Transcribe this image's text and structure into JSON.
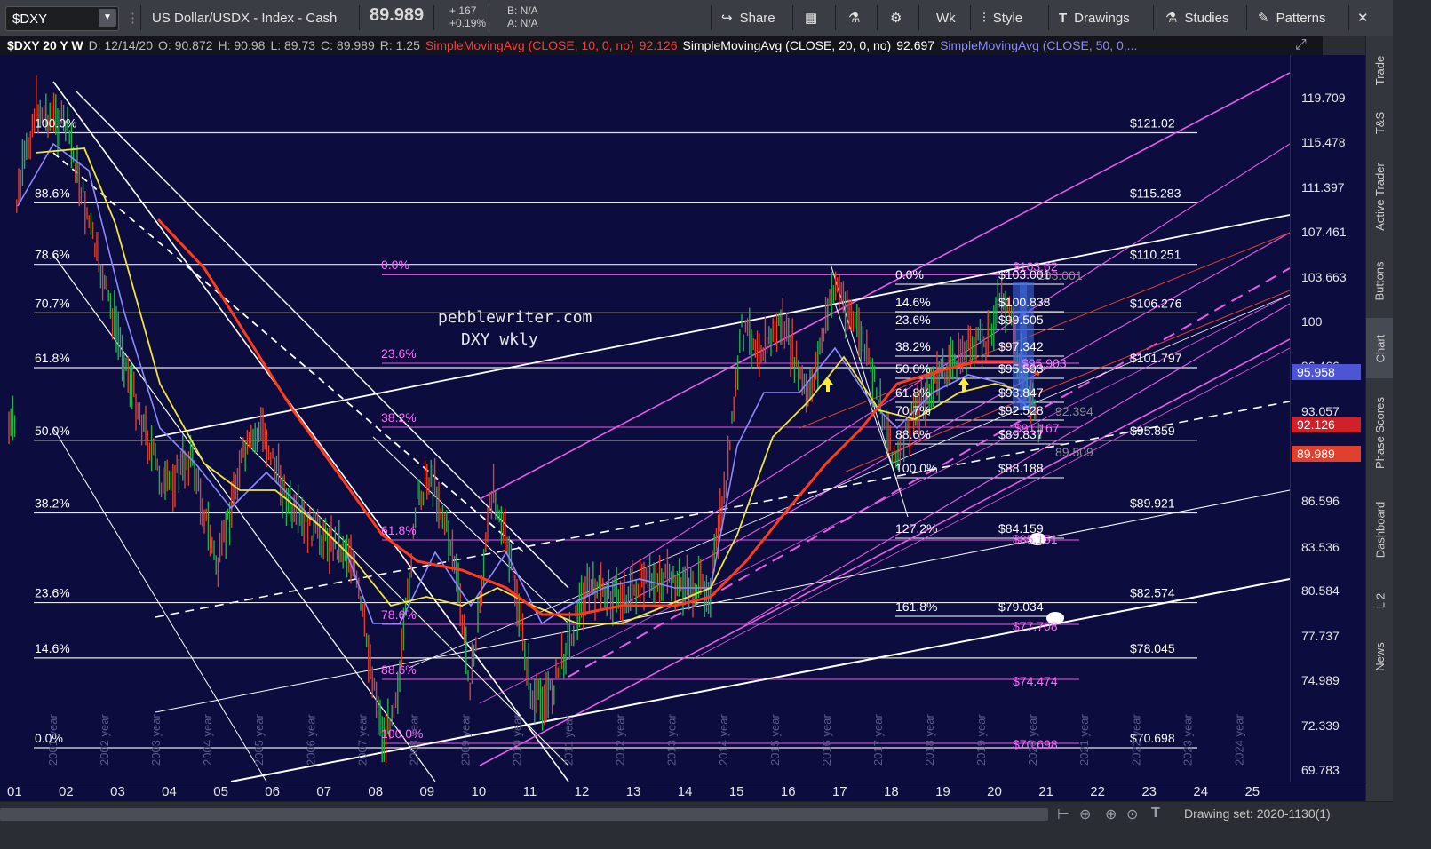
{
  "toolbar": {
    "symbol": "$DXY",
    "description": "US Dollar/USDX - Index - Cash",
    "last_price": "89.989",
    "change": "+.167",
    "change_pct": "+0.19%",
    "bid": "B: N/A",
    "ask": "A: N/A",
    "share": "Share",
    "period": "Wk",
    "style": "Style",
    "drawings": "Drawings",
    "studies": "Studies",
    "patterns": "Patterns"
  },
  "info_bar": {
    "symbol_tf": "$DXY 20 Y W",
    "date": "D: 12/14/20",
    "open": "O: 90.872",
    "high": "H: 90.98",
    "low": "L: 89.73",
    "close": "C: 89.989",
    "range": "R: 1.25",
    "sma10": "SimpleMovingAvg (CLOSE, 10, 0, no)",
    "sma10_val": "92.126",
    "sma20": "SimpleMovingAvg (CLOSE, 20, 0, no)",
    "sma20_val": "92.697",
    "sma50": "SimpleMovingAvg (CLOSE, 50, 0,..."
  },
  "watermark": {
    "line1": "pebblewriter.com",
    "line2": "DXY wkly"
  },
  "y_axis": {
    "labels": [
      "119.709",
      "115.478",
      "111.397",
      "107.461",
      "103.663",
      "100",
      "96.466",
      "93.057",
      "89.772",
      "86.596",
      "83.536",
      "80.584",
      "77.737",
      "74.989",
      "72.339",
      "69.783"
    ],
    "tags": [
      {
        "value": "95.958",
        "color": "#4b55d6"
      },
      {
        "value": "92.126",
        "color": "#d0202a"
      },
      {
        "value": "89.989",
        "color": "#e0402e"
      }
    ]
  },
  "x_axis": {
    "labels": [
      "01",
      "02",
      "03",
      "04",
      "05",
      "06",
      "07",
      "08",
      "09",
      "10",
      "11",
      "12",
      "13",
      "14",
      "15",
      "16",
      "17",
      "18",
      "19",
      "20",
      "21",
      "22",
      "23",
      "24",
      "25"
    ]
  },
  "fib_main": {
    "pcts": [
      "100.0%",
      "88.6%",
      "78.6%",
      "70.7%",
      "61.8%",
      "50.0%",
      "38.2%",
      "23.6%",
      "14.6%",
      "0.0%"
    ],
    "prices": [
      "$121.02",
      "$115.283",
      "$110.251",
      "$106.276",
      "$101.797",
      "$95.859",
      "$89.921",
      "$82.574",
      "$78.045",
      "$70.698"
    ]
  },
  "fib_pink": {
    "pcts": [
      "0.0%",
      "23.6%",
      "38.2%",
      "61.8%",
      "78.6%",
      "88.6%",
      "100.0%"
    ],
    "prices": [
      "$103.62",
      "$85.151",
      "$77.708",
      "$74.474",
      "$70.698"
    ]
  },
  "fib_small": {
    "pcts": [
      "0.0%",
      "14.6%",
      "23.6%",
      "38.2%",
      "50.0%",
      "61.8%",
      "70.7%",
      "88.6%",
      "100.0%",
      "127.2%",
      "161.8%"
    ],
    "prices": [
      "$103.001",
      "$100.838",
      "$99.505",
      "$97.342",
      "$95.593",
      "$93.847",
      "$92.528",
      "$89.837",
      "$88.188",
      "$84.159",
      "$79.034"
    ],
    "gray_labels": [
      "103.001",
      "92.394",
      "89.509"
    ],
    "pink_labels": [
      "$95.903",
      "$91.167"
    ]
  },
  "year_labels": [
    "2001 year",
    "2002 year",
    "2003 year",
    "2004 year",
    "2005 year",
    "2006 year",
    "2007 year",
    "2008 year",
    "2009 year",
    "2010 year",
    "2011 year",
    "2012 year",
    "2013 year",
    "2014 year",
    "2015 year",
    "2016 year",
    "2017 year",
    "2018 year",
    "2019 year",
    "2020 year",
    "2021 year",
    "2022 year",
    "2023 year",
    "2024 year"
  ],
  "right_tabs": [
    "Trade",
    "T&S",
    "Active Trader",
    "Buttons",
    "Chart",
    "Phase Scores",
    "Dashboard",
    "L 2",
    "News"
  ],
  "bottom": {
    "drawing_set": "Drawing set: 2020-1130(1)"
  },
  "chart_data": {
    "type": "candlestick",
    "title": "DXY wkly",
    "x": [
      "01",
      "02",
      "03",
      "04",
      "05",
      "06",
      "07",
      "08",
      "09",
      "10",
      "11",
      "12",
      "13",
      "14",
      "15",
      "16",
      "17",
      "18",
      "19",
      "20",
      "21"
    ],
    "y_range": [
      69.783,
      121.02
    ],
    "series": [
      {
        "name": "SimpleMovingAvg (CLOSE, 10, 0, no)",
        "color": "#ff3b3b",
        "last": 92.126
      },
      {
        "name": "SimpleMovingAvg (CLOSE, 20, 0, no)",
        "color": "#ffffff",
        "last": 92.697
      },
      {
        "name": "SimpleMovingAvg (CLOSE, 50, 0,...",
        "color": "#8080ff",
        "last": 95.958
      }
    ],
    "last_close": 89.989
  }
}
